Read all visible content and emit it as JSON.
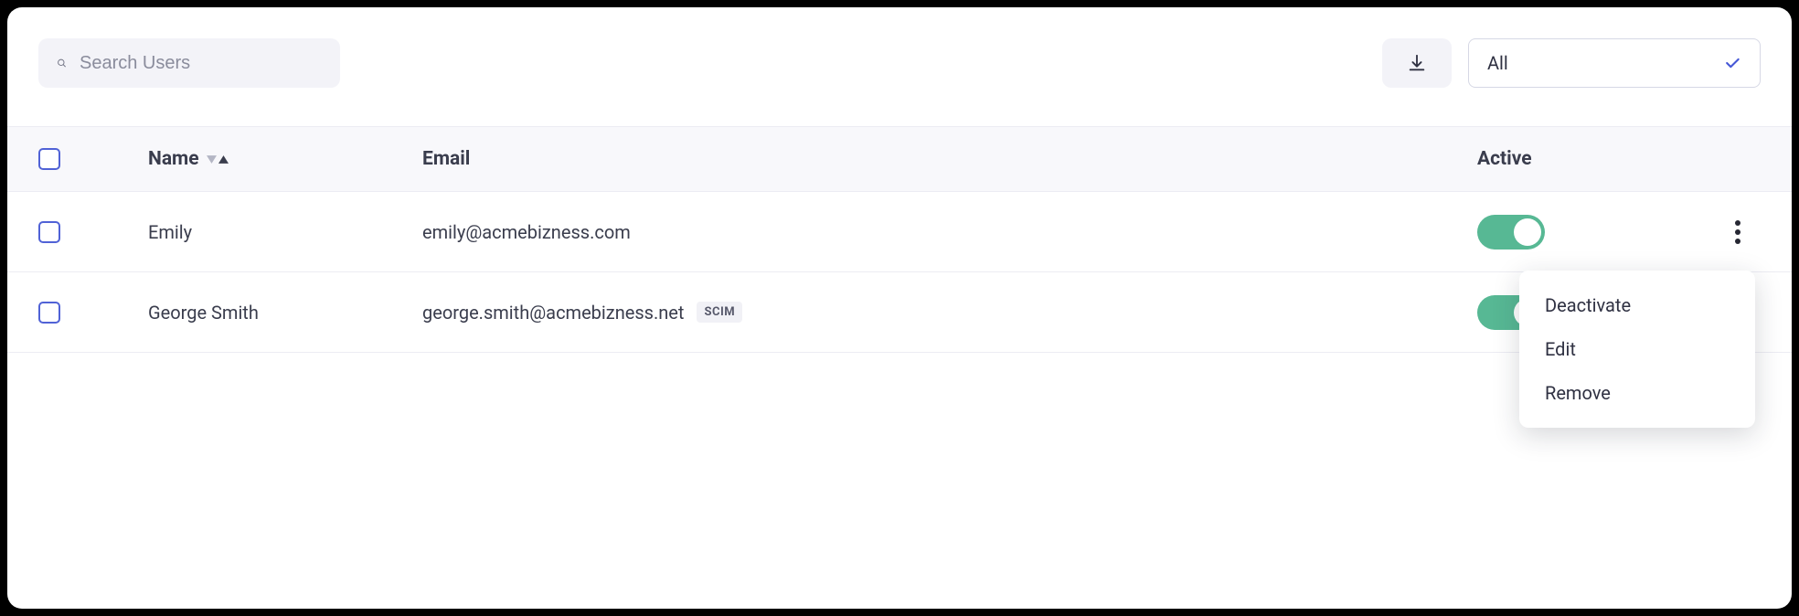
{
  "search": {
    "placeholder": "Search Users"
  },
  "filter": {
    "selected": "All"
  },
  "columns": {
    "name": "Name",
    "email": "Email",
    "active": "Active"
  },
  "rows": [
    {
      "name": "Emily",
      "email": "emily@acmebizness.com",
      "scim": false,
      "active": true
    },
    {
      "name": "George Smith",
      "email": "george.smith@acmebizness.net",
      "scim": true,
      "active": true
    }
  ],
  "badge": {
    "scim": "SCIM"
  },
  "menu": {
    "deactivate": "Deactivate",
    "edit": "Edit",
    "remove": "Remove"
  }
}
